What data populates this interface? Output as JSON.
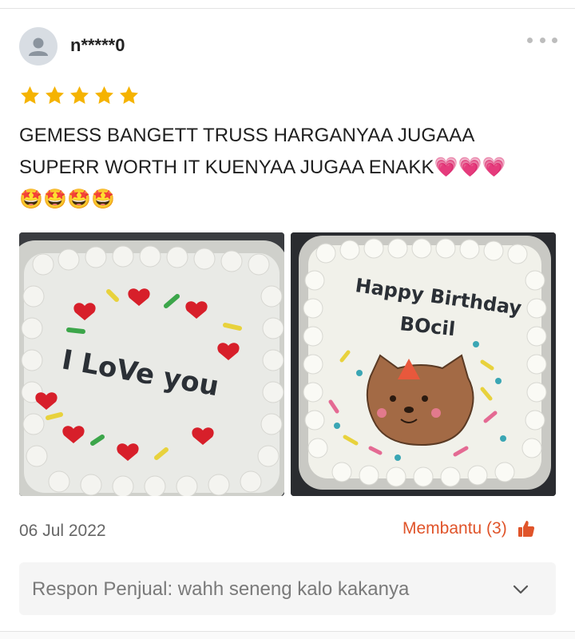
{
  "review": {
    "username": "n*****0",
    "rating": 5,
    "text": "GEMESS BANGETT TRUSS HARGANYAA JUGAAA\nSUPERR WORTH IT KUENYAA JUGAA ENAKK💗💗💗\n🤩🤩🤩🤩",
    "date": "06 Jul 2022",
    "helpful_label": "Membantu (3)",
    "photos": [
      {
        "icon": "cake-photo",
        "cake_text": "I LoVe you"
      },
      {
        "icon": "cake-photo",
        "cake_text_line1": "Happy Birthday",
        "cake_text_line2": "BOcil"
      }
    ]
  },
  "seller_response": {
    "text": "Respon Penjual: wahh seneng kalo kakanya"
  },
  "icons": {
    "avatar": "user-avatar-icon",
    "more": "more-dots-icon",
    "star": "star-icon",
    "thumb": "thumbs-up-icon",
    "chevron": "chevron-down-icon"
  },
  "colors": {
    "star": "#f5b301",
    "accent": "#e0542a",
    "muted_text": "#666666",
    "seller_box_bg": "#f5f5f5"
  }
}
